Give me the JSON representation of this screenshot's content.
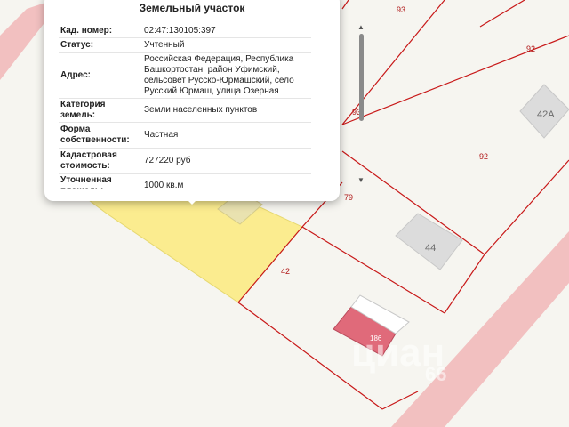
{
  "popup": {
    "title": "Земельный участок",
    "close_icon": "close-icon",
    "rows": [
      {
        "label": "Кад. номер:",
        "value": "02:47:130105:397"
      },
      {
        "label": "Статус:",
        "value": "Учтенный"
      },
      {
        "label": "Адрес:",
        "value": "Российская Федерация, Республика Башкортостан, район Уфимский, сельсовет Русско-Юрмашский, село Русский Юрмаш, улица Озерная"
      },
      {
        "label": "Категория земель:",
        "value": "Земли населенных пунктов"
      },
      {
        "label": "Форма собственности:",
        "value": "Частная"
      },
      {
        "label": "Кадастровая стоимость:",
        "value": "727220 руб"
      },
      {
        "label": "Уточненная площадь:",
        "value": "1000 кв.м"
      }
    ]
  },
  "map": {
    "parcel_labels": [
      "93",
      "92",
      "93",
      "92",
      "79",
      "42"
    ],
    "house_labels": [
      "42А",
      "44"
    ],
    "building_number": "186",
    "watermark": "циан",
    "watermark_digits": "66",
    "colors": {
      "road": "#f0b4b4",
      "selected_parcel": "#fbec8f",
      "parcel_border": "#c81818",
      "house": "#dcdcdc",
      "building": "#e06a7a"
    }
  }
}
